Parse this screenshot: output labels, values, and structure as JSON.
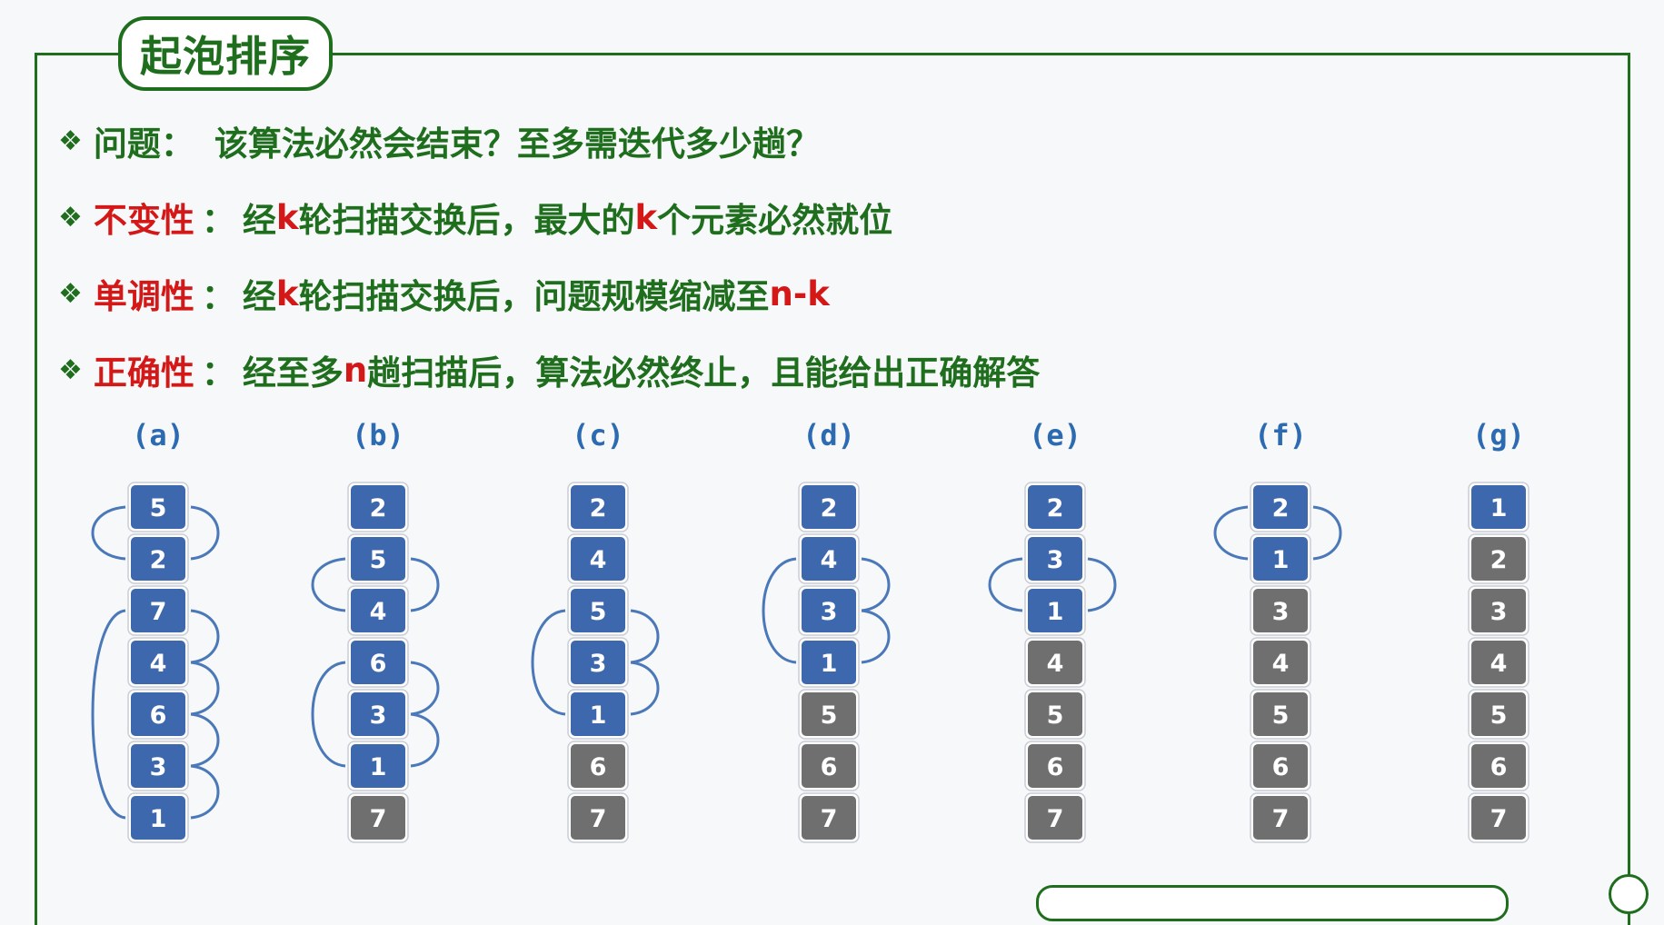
{
  "title": "起泡排序",
  "points": [
    {
      "label": "问题：",
      "text": "该算法必然会结束？至多需迭代多少趟？"
    },
    {
      "label": "不变性",
      "colon": "：",
      "segments": [
        "经",
        "k",
        "轮扫描交换后，最大的",
        "k",
        "个元素必然就位"
      ]
    },
    {
      "label": "单调性",
      "colon": "：",
      "segments": [
        "经",
        "k",
        "轮扫描交换后，问题规模缩减至",
        "n-k"
      ]
    },
    {
      "label": "正确性",
      "colon": "：",
      "segments": [
        "经至多",
        "n",
        "趟扫描后，算法必然终止，且能给出正确解答"
      ]
    }
  ],
  "columns": [
    {
      "label": "(a)",
      "values": [
        5,
        2,
        7,
        4,
        6,
        3,
        1
      ],
      "done": 0
    },
    {
      "label": "(b)",
      "values": [
        2,
        5,
        4,
        6,
        3,
        1,
        7
      ],
      "done": 1
    },
    {
      "label": "(c)",
      "values": [
        2,
        4,
        5,
        3,
        1,
        6,
        7
      ],
      "done": 2
    },
    {
      "label": "(d)",
      "values": [
        2,
        4,
        3,
        1,
        5,
        6,
        7
      ],
      "done": 3
    },
    {
      "label": "(e)",
      "values": [
        2,
        3,
        1,
        4,
        5,
        6,
        7
      ],
      "done": 4
    },
    {
      "label": "(f)",
      "values": [
        2,
        1,
        3,
        4,
        5,
        6,
        7
      ],
      "done": 5
    },
    {
      "label": "(g)",
      "values": [
        1,
        2,
        3,
        4,
        5,
        6,
        7
      ],
      "done": 6
    }
  ],
  "colors": {
    "sorted_box": "#6f6f6f",
    "active_box": "#3d68ae",
    "accent_green": "#1e6e1e",
    "accent_red": "#d41818",
    "arc": "#4a78b8"
  }
}
